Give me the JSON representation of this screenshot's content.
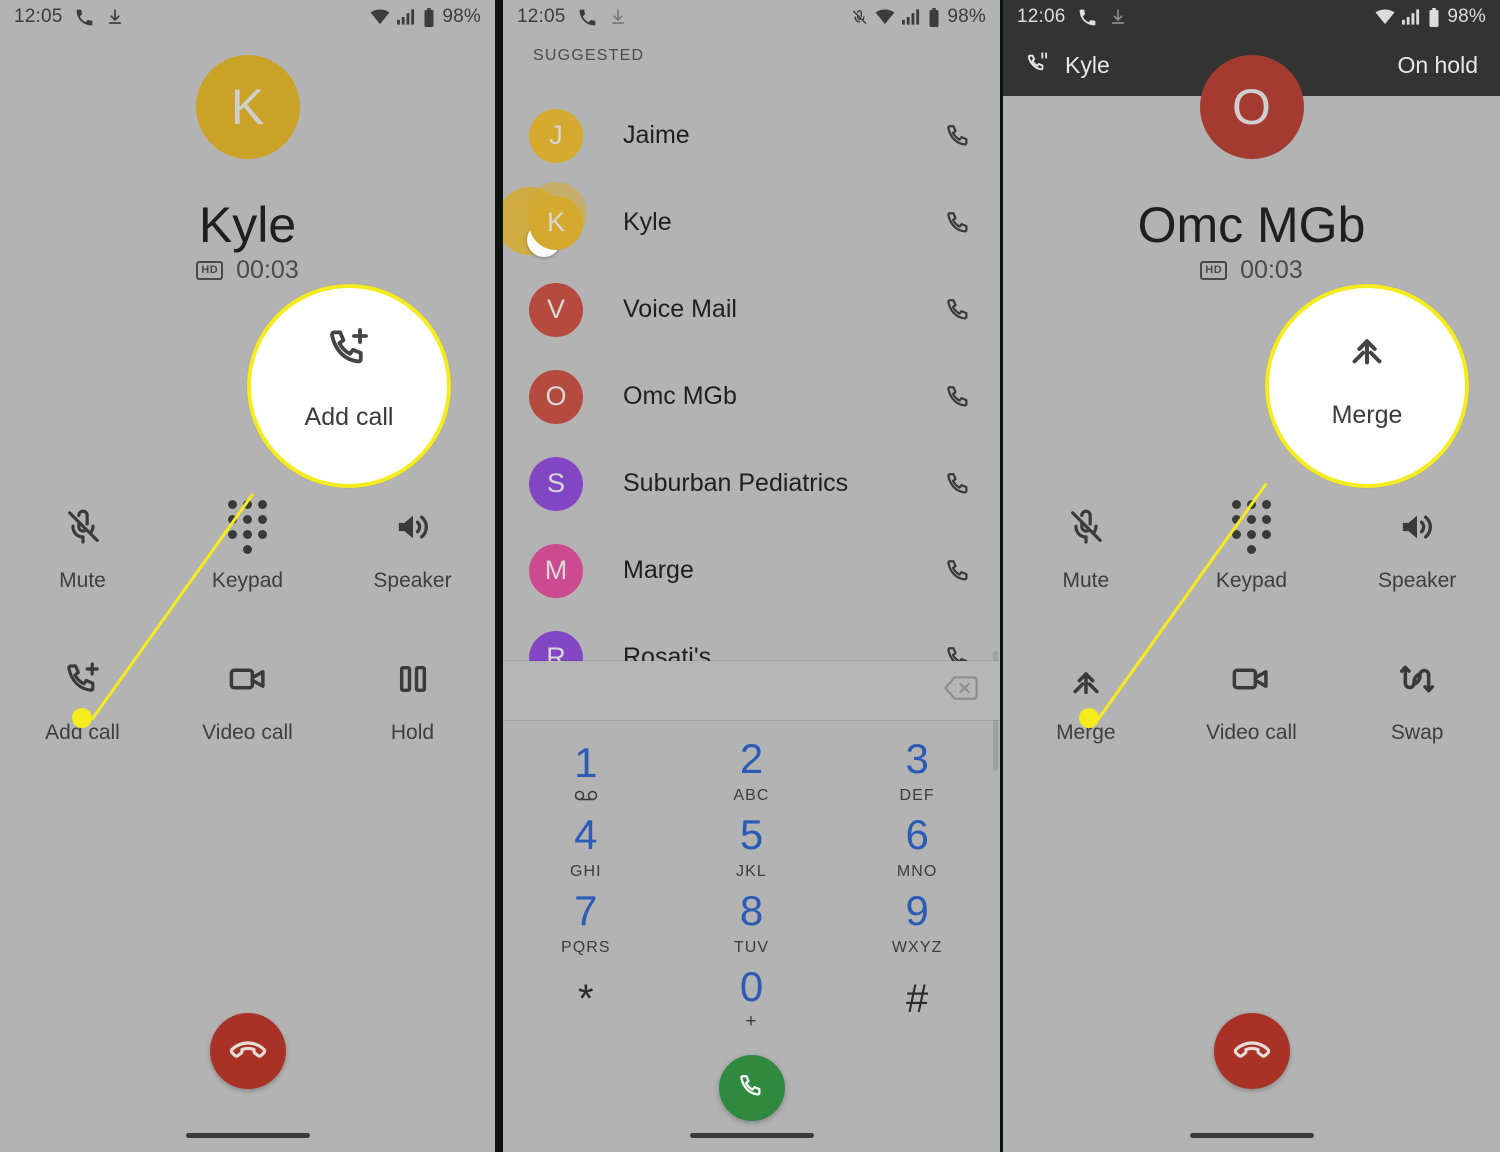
{
  "panels": [
    {
      "id": "active-call-kyle",
      "statusbar": {
        "time": "12:05",
        "battery": "98%",
        "icons": [
          "phone-call-icon",
          "download-icon",
          "wifi-icon",
          "signal-icon",
          "battery-icon"
        ]
      },
      "avatar": {
        "initial": "K",
        "color": "#c9a227"
      },
      "contact_name": "Kyle",
      "hd_badge": "HD",
      "duration": "00:03",
      "controls": [
        {
          "label": "Mute",
          "icon": "mic-off-icon"
        },
        {
          "label": "Keypad",
          "icon": "dialpad-icon"
        },
        {
          "label": "Speaker",
          "icon": "speaker-icon"
        },
        {
          "label": "Add call",
          "icon": "add-call-icon"
        },
        {
          "label": "Video call",
          "icon": "video-camera-icon"
        },
        {
          "label": "Hold",
          "icon": "pause-icon"
        }
      ],
      "callout": {
        "label": "Add call",
        "icon": "add-call-icon",
        "ring_color": "#f5ec1d"
      },
      "end_call_icon": "end-call-icon",
      "end_call_color": "#a93226"
    },
    {
      "id": "dialer-suggested",
      "statusbar": {
        "time": "12:05",
        "battery": "98%",
        "icons": [
          "phone-call-icon",
          "download-icon",
          "mute-icon",
          "wifi-icon",
          "signal-icon",
          "battery-icon"
        ]
      },
      "section_label": "SUGGESTED",
      "contacts": [
        {
          "initial": "J",
          "name": "Jaime",
          "color": "#d3a92e"
        },
        {
          "initial": "K",
          "name": "Kyle",
          "color": "#d3a92e",
          "highlighted": true
        },
        {
          "initial": "V",
          "name": "Voice Mail",
          "color": "#b54b3e"
        },
        {
          "initial": "O",
          "name": "Omc MGb",
          "color": "#b54b3e"
        },
        {
          "initial": "S",
          "name": "Suburban Pediatrics",
          "color": "#8246c4"
        },
        {
          "initial": "M",
          "name": "Marge",
          "color": "#cc4a90"
        },
        {
          "initial": "R",
          "name": "Rosati's",
          "color": "#8246c4"
        }
      ],
      "row_call_icon": "phone-call-icon",
      "backspace_icon": "backspace-icon",
      "dial_input_value": "",
      "keys": [
        {
          "num": "1",
          "sub": "",
          "glyph": "voicemail-icon"
        },
        {
          "num": "2",
          "sub": "ABC"
        },
        {
          "num": "3",
          "sub": "DEF"
        },
        {
          "num": "4",
          "sub": "GHI"
        },
        {
          "num": "5",
          "sub": "JKL"
        },
        {
          "num": "6",
          "sub": "MNO"
        },
        {
          "num": "7",
          "sub": "PQRS"
        },
        {
          "num": "8",
          "sub": "TUV"
        },
        {
          "num": "9",
          "sub": "WXYZ"
        },
        {
          "num": "*",
          "sub": ""
        },
        {
          "num": "0",
          "sub": "+"
        },
        {
          "num": "#",
          "sub": ""
        }
      ],
      "call_button_icon": "phone-call-icon",
      "call_button_color": "#2f8a3f"
    },
    {
      "id": "active-call-omc-mgb",
      "statusbar": {
        "time": "12:06",
        "battery": "98%",
        "icons": [
          "phone-call-icon",
          "download-icon",
          "wifi-icon",
          "signal-icon",
          "battery-icon"
        ]
      },
      "call_header": {
        "icon": "call-on-hold-icon",
        "name": "Kyle",
        "status": "On hold"
      },
      "avatar": {
        "initial": "O",
        "color": "#a33b30"
      },
      "contact_name": "Omc MGb",
      "hd_badge": "HD",
      "duration": "00:03",
      "controls": [
        {
          "label": "Mute",
          "icon": "mic-off-icon"
        },
        {
          "label": "Keypad",
          "icon": "dialpad-icon"
        },
        {
          "label": "Speaker",
          "icon": "speaker-icon"
        },
        {
          "label": "Merge",
          "icon": "merge-calls-icon"
        },
        {
          "label": "Video call",
          "icon": "video-camera-icon"
        },
        {
          "label": "Swap",
          "icon": "swap-calls-icon"
        }
      ],
      "callout": {
        "label": "Merge",
        "icon": "merge-calls-icon",
        "ring_color": "#f5ec1d"
      },
      "end_call_icon": "end-call-icon",
      "end_call_color": "#a93226"
    }
  ]
}
